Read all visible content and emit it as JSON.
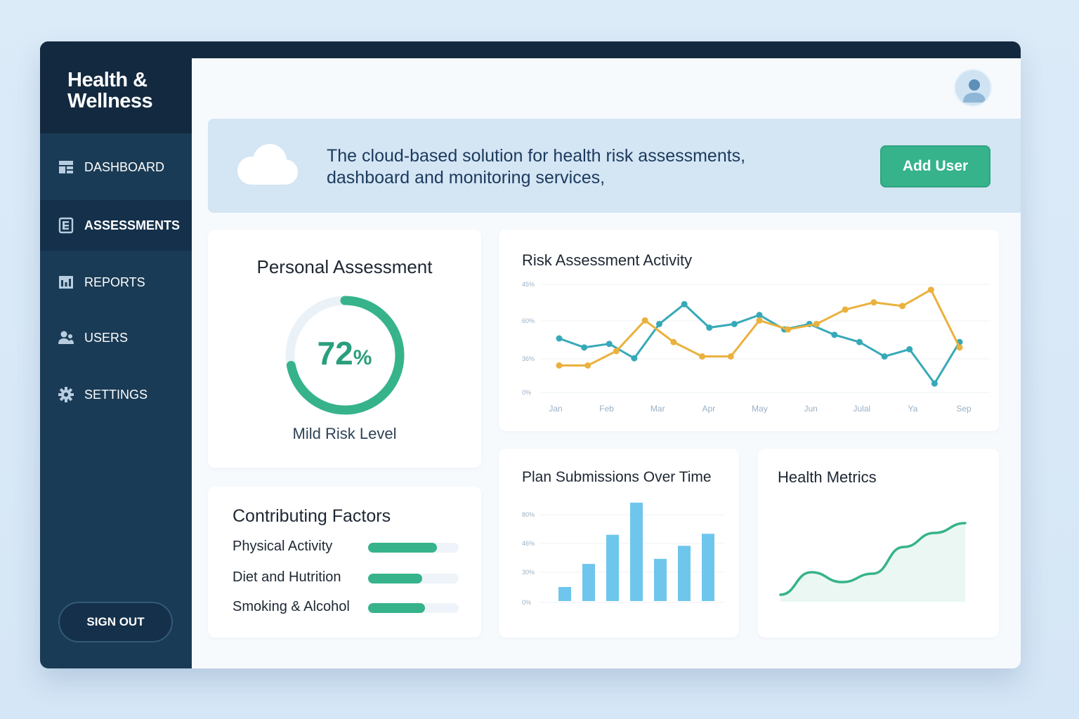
{
  "app": {
    "brand_line1": "Health &",
    "brand_line2": "Wellness"
  },
  "sidebar": {
    "items": [
      {
        "label": "DASHBOARD",
        "icon": "dashboard-icon",
        "active": false
      },
      {
        "label": "ASSESSMENTS",
        "icon": "assessments-icon",
        "active": true
      },
      {
        "label": "REPORTS",
        "icon": "reports-icon",
        "active": false
      },
      {
        "label": "USERS",
        "icon": "users-icon",
        "active": false
      },
      {
        "label": "SETTINGS",
        "icon": "gear-icon",
        "active": false
      }
    ],
    "signout_label": "SIGN OUT"
  },
  "header": {
    "avatar_icon": "user-avatar-icon"
  },
  "banner": {
    "icon": "cloud-icon",
    "line1": "The cloud-based solution for health risk assessments,",
    "line2": "dashboard and monitoring services,",
    "button_label": "Add User"
  },
  "personal": {
    "title": "Personal Assessment",
    "value": 72,
    "value_suffix": "%",
    "risk_label": "Mild Risk Level"
  },
  "factors": {
    "title": "Contributing Factors",
    "items": [
      {
        "label": "Physical Activity",
        "level": 0.76
      },
      {
        "label": "Diet and Hutrition",
        "level": 0.6
      },
      {
        "label": "Smoking & Alcohol",
        "level": 0.63
      }
    ]
  },
  "colors": {
    "accent_green": "#36b38b",
    "teal_series": "#36a9b8",
    "orange_series": "#eab13d",
    "bar_blue": "#6fc6ec",
    "sidebar_bg": "#1a3b55"
  },
  "chart_data": [
    {
      "type": "line",
      "title": "Risk Assessment Activity",
      "categories": [
        "Jan",
        "Feb",
        "Mar",
        "Apr",
        "May",
        "Jun",
        "Julal",
        "Ya",
        "Sep"
      ],
      "y_tick_labels": [
        "45%",
        "60%",
        "36%",
        "0%"
      ],
      "grid": true,
      "series": [
        {
          "color": "#36a9b8",
          "values": [
            30,
            25,
            27,
            19,
            38,
            49,
            36,
            38,
            43,
            35,
            38,
            32,
            28,
            20,
            24,
            5,
            28
          ]
        },
        {
          "color": "#eab13d",
          "values": [
            15,
            15,
            23,
            40,
            28,
            20,
            20,
            40,
            35,
            38,
            46,
            50,
            48,
            57,
            25
          ]
        }
      ]
    },
    {
      "type": "bar",
      "title": "Plan Submissions Over Time",
      "y_tick_labels": [
        "80%",
        "46%",
        "30%",
        "0%"
      ],
      "grid": true,
      "values": [
        14,
        37,
        66,
        98,
        42,
        55,
        67
      ]
    },
    {
      "type": "area",
      "title": "Health Metrics",
      "values": [
        10,
        42,
        28,
        40,
        78,
        98,
        112
      ]
    }
  ]
}
